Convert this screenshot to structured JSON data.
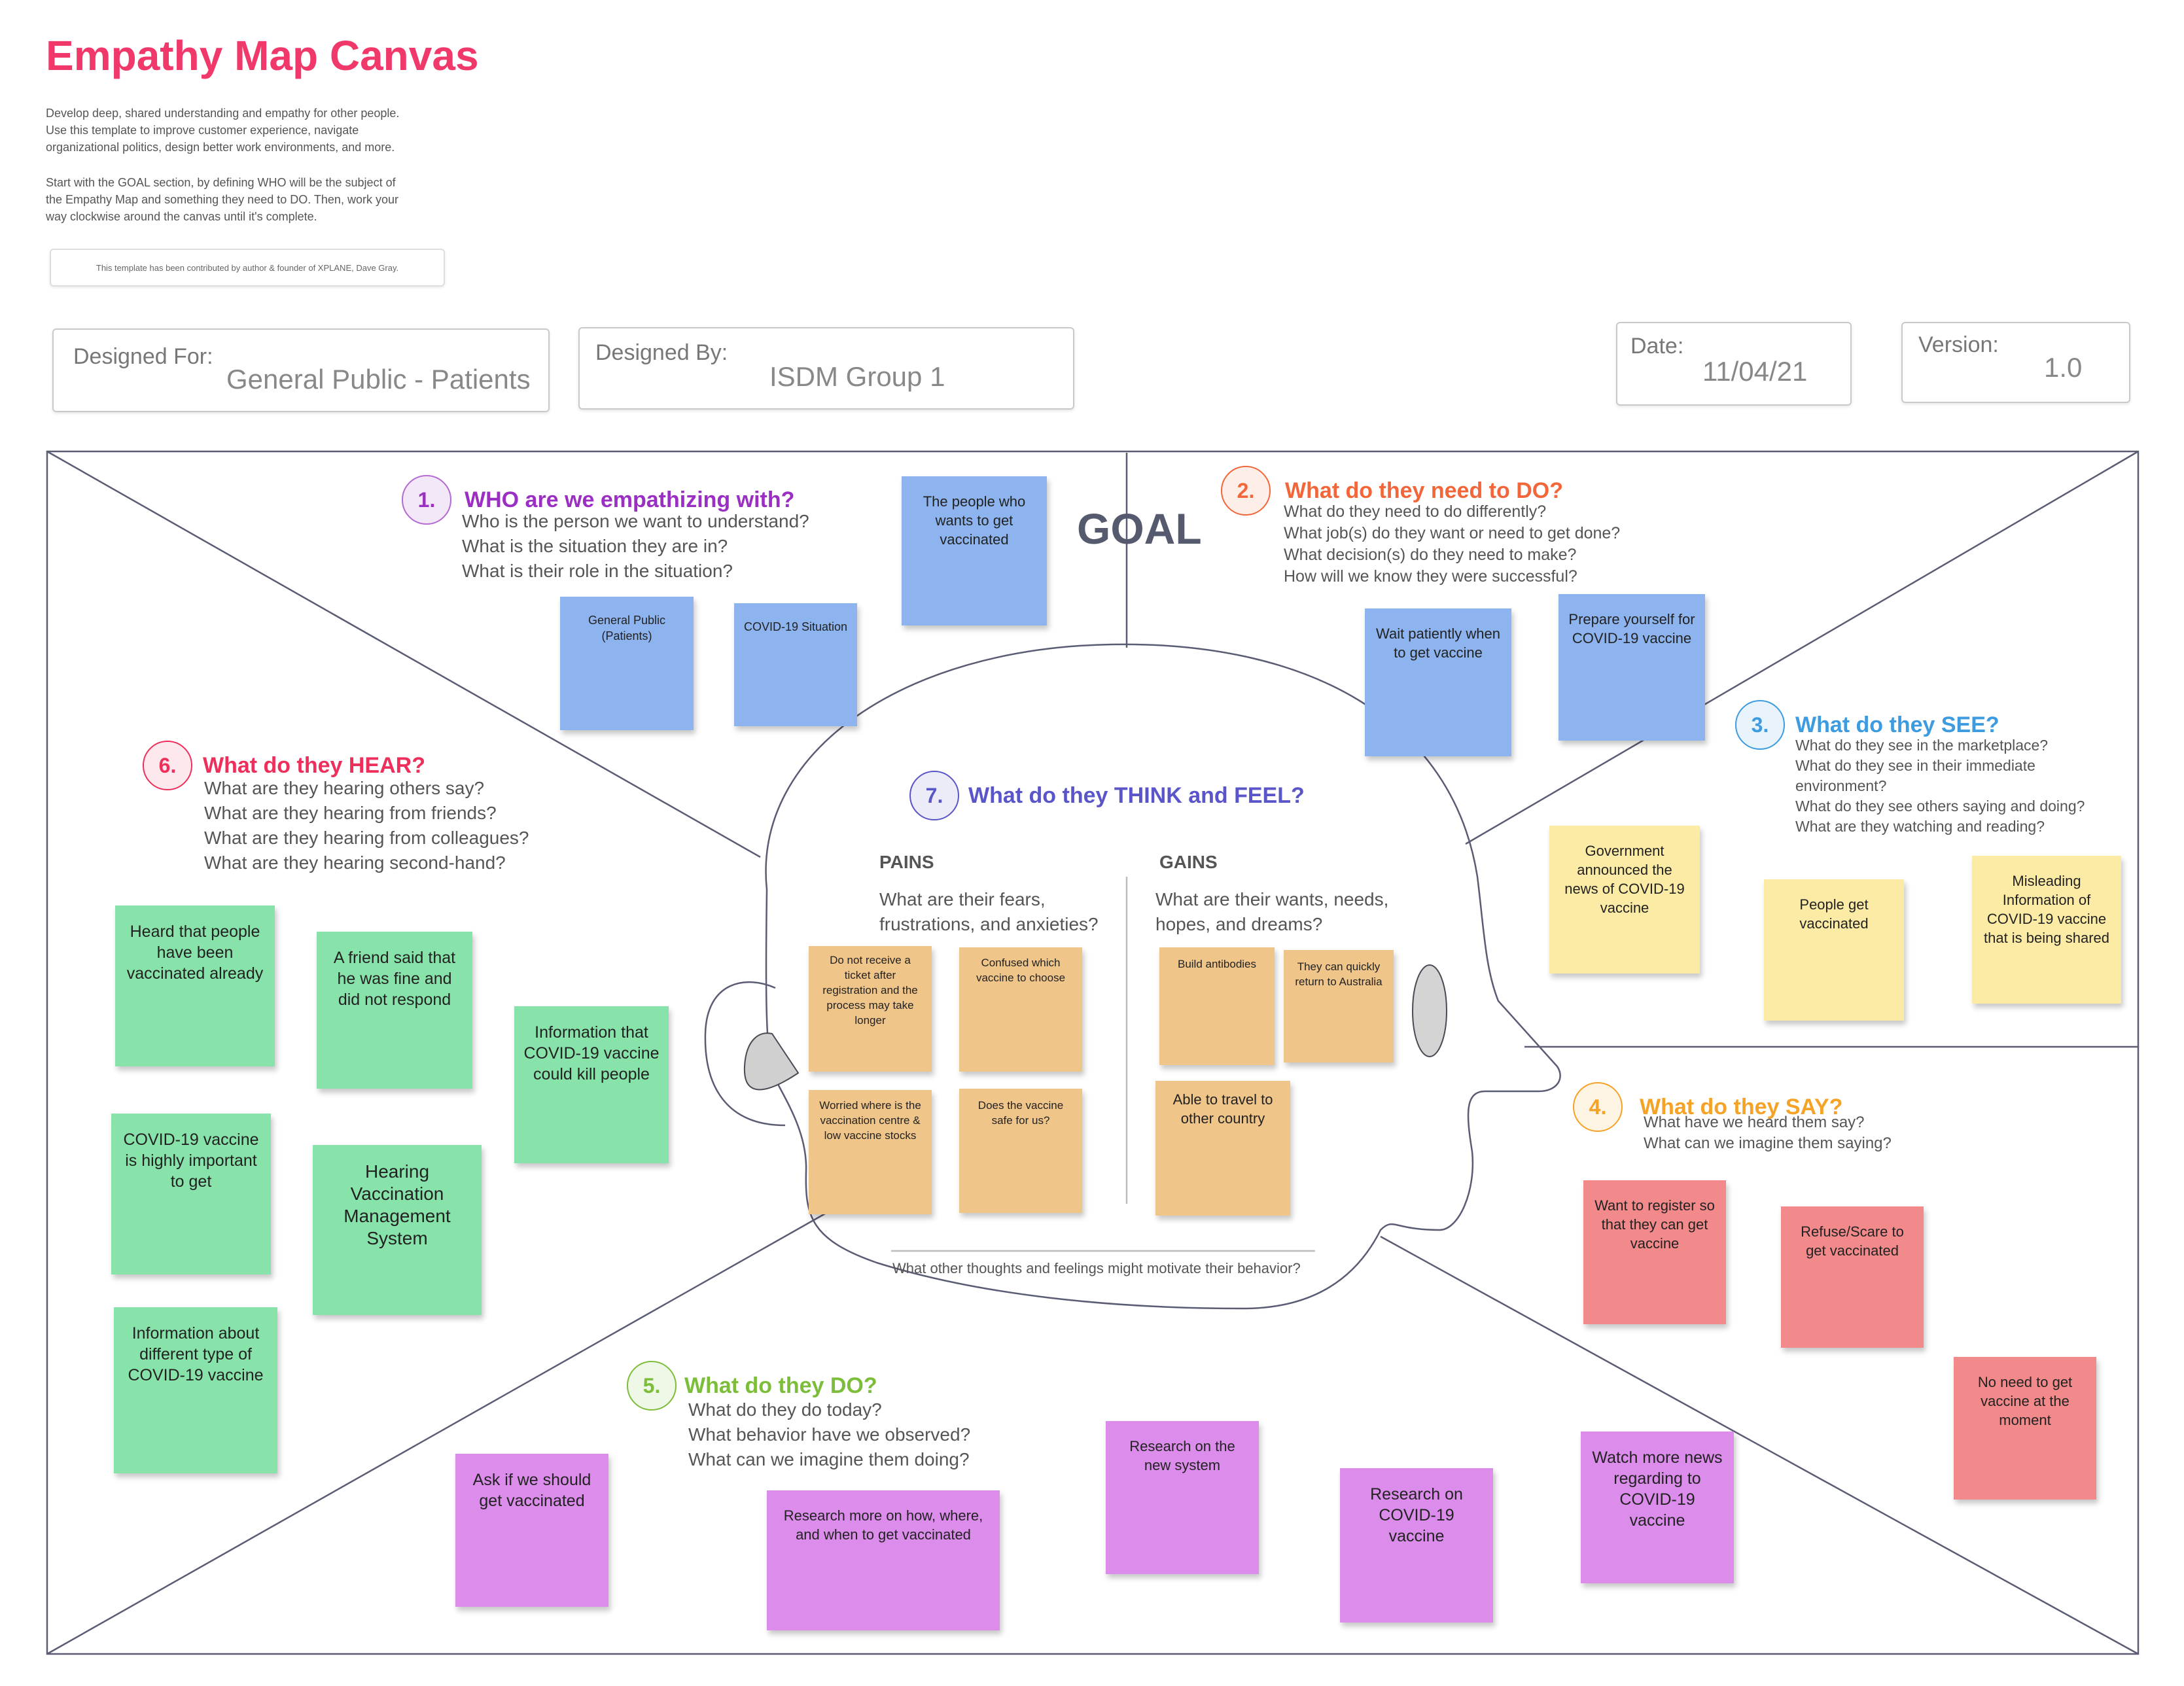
{
  "header": {
    "title": "Empathy Map Canvas",
    "intro1": [
      "Develop deep, shared understanding and empathy for other people.",
      "Use this template to improve customer experience, navigate",
      "organizational politics, design better work environments, and more."
    ],
    "intro2": [
      "Start with the GOAL section, by defining WHO will be the subject of",
      "the Empathy Map and something they need to DO. Then, work your",
      "way clockwise around the canvas until it's complete."
    ],
    "credit": "This template has been contributed by author & founder of XPLANE, Dave Gray."
  },
  "meta": {
    "designed_for_label": "Designed For:",
    "designed_for_value": "General Public - Patients",
    "designed_by_label": "Designed By:",
    "designed_by_value": "ISDM Group 1",
    "date_label": "Date:",
    "date_value": "11/04/21",
    "version_label": "Version:",
    "version_value": "1.0"
  },
  "goal_label": "GOAL",
  "sections": {
    "who": {
      "num": "1.",
      "title": "WHO are we empathizing with?",
      "color": "#9b2fc4",
      "questions": [
        "Who is the person we want to understand?",
        "What is the situation they are in?",
        "What is their role in the situation?"
      ]
    },
    "do_need": {
      "num": "2.",
      "title": "What do they need to DO?",
      "color": "#f2663a",
      "questions": [
        "What do they need to do differently?",
        "What job(s) do they want or need to get done?",
        "What decision(s) do they need to make?",
        "How will we know they were successful?"
      ]
    },
    "see": {
      "num": "3.",
      "title": "What do they SEE?",
      "color": "#3d9be0",
      "questions": [
        "What do they see in the marketplace?",
        "What do they see in their immediate",
        "environment?",
        "What do they see others saying and doing?",
        "What are they watching and reading?"
      ]
    },
    "say": {
      "num": "4.",
      "title": "What do they SAY?",
      "color": "#f5a327",
      "questions": [
        "What have we heard them say?",
        "What can we imagine them saying?"
      ]
    },
    "do": {
      "num": "5.",
      "title": "What do they DO?",
      "color": "#7cbd3a",
      "questions": [
        "What do they do today?",
        "What behavior have we observed?",
        "What can we imagine them doing?"
      ]
    },
    "hear": {
      "num": "6.",
      "title": "What do they HEAR?",
      "color": "#ee2f5c",
      "questions": [
        "What are they hearing others say?",
        "What are they hearing from friends?",
        "What are they hearing from colleagues?",
        "What are they hearing second-hand?"
      ]
    },
    "think": {
      "num": "7.",
      "title": "What do they THINK and FEEL?",
      "color": "#5a55c8",
      "pains_label": "PAINS",
      "pains_q": [
        "What are their fears,",
        "frustrations, and anxieties?"
      ],
      "gains_label": "GAINS",
      "gains_q": [
        "What are their wants, needs,",
        "hopes, and dreams?"
      ],
      "footer": "What other thoughts and feelings might motivate their behavior?"
    }
  },
  "notes": {
    "who_1": "General Public (Patients)",
    "who_2": "COVID-19 Situation",
    "goal_1": "The people who wants to get vaccinated",
    "do_need_1": "Wait patiently when to get vaccine",
    "do_need_2": "Prepare yourself for COVID-19 vaccine",
    "see_1": "Government announced the news of COVID-19 vaccine",
    "see_2": "People get vaccinated",
    "see_3": "Misleading Information of COVID-19 vaccine that is being shared",
    "say_1": "Want to register so that they can get vaccine",
    "say_2": "Refuse/Scare to get vaccinated",
    "say_3": "No need to get vaccine at the moment",
    "do_1": "Ask if we should get vaccinated",
    "do_2": "Research more on how, where, and when to get vaccinated",
    "do_3": "Research on the new system",
    "do_4": "Research on COVID-19 vaccine",
    "do_5": "Watch more news regarding to COVID-19 vaccine",
    "hear_1": "Heard that people have been vaccinated already",
    "hear_2": "A friend said that he was fine and did not respond",
    "hear_3": "Information that COVID-19 vaccine could kill people",
    "hear_4": "COVID-19 vaccine is highly important to get",
    "hear_5": "Hearing Vaccination Management System",
    "hear_6": "Information about different type of COVID-19 vaccine",
    "pain_1": "Do not receive a ticket after registration and the process may take longer",
    "pain_2": "Confused which vaccine to choose",
    "pain_3": "Worried where is the vaccination centre & low vaccine stocks",
    "pain_4": "Does the vaccine safe for us?",
    "gain_1": "Build antibodies",
    "gain_2": "They can quickly return to Australia",
    "gain_3": "Able to travel to other country"
  }
}
